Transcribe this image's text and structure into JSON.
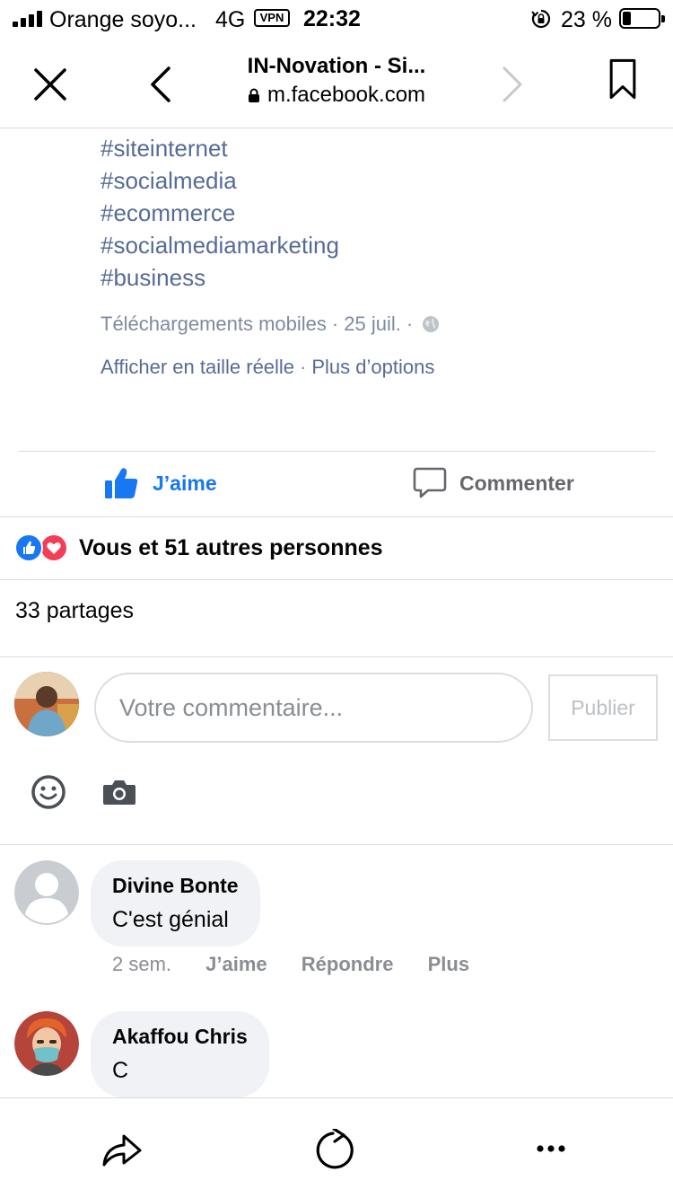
{
  "status_bar": {
    "carrier": "Orange soyo...",
    "network": "4G",
    "vpn": "VPN",
    "time": "22:32",
    "battery": "23 %"
  },
  "browser": {
    "title": "IN-Novation - Si...",
    "url": "m.facebook.com"
  },
  "post": {
    "hashtags": [
      "#siteinternet",
      "#socialmedia",
      "#ecommerce",
      "#socialmediamarketing",
      "#business"
    ],
    "album": "Téléchargements mobiles",
    "date": "25 juil.",
    "separator": "·",
    "view_full": "Afficher en taille réelle",
    "more_options": "Plus d’options"
  },
  "actions": {
    "like": "J’aime",
    "comment": "Commenter"
  },
  "reactions": {
    "summary": "Vous et 51 autres personnes",
    "shares": "33 partages"
  },
  "composer": {
    "placeholder": "Votre commentaire...",
    "publish": "Publier"
  },
  "comments": [
    {
      "author": "Divine Bonte",
      "text": "C'est génial",
      "time": "2 sem.",
      "like": "J’aime",
      "reply": "Répondre",
      "more": "Plus"
    },
    {
      "author": "Akaffou Chris",
      "text": "C"
    }
  ],
  "colors": {
    "link": "#576b95",
    "like_blue": "#1877f2",
    "love_red": "#f33e58",
    "bubble": "#f0f2f5"
  }
}
